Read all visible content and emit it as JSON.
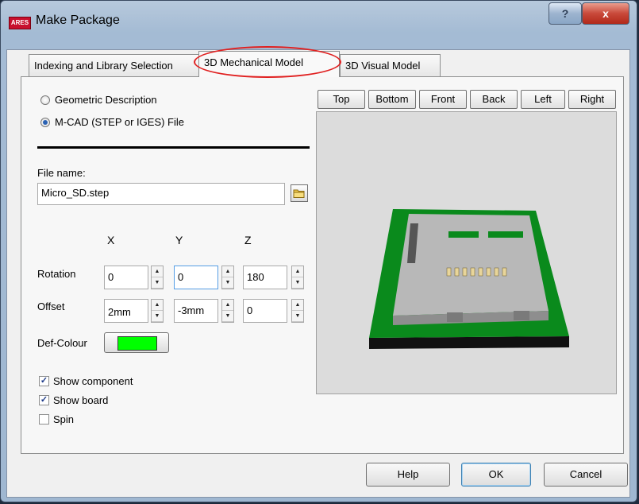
{
  "window": {
    "title": "Make Package",
    "app_badge": "ARES",
    "help_glyph": "?",
    "close_glyph": "x"
  },
  "tabs": [
    {
      "label": "Indexing and Library Selection"
    },
    {
      "label": "3D Mechanical Model"
    },
    {
      "label": "3D Visual Model"
    }
  ],
  "source": {
    "option_geometric": "Geometric Description",
    "option_mcad": "M-CAD (STEP or IGES) File",
    "selected": "mcad"
  },
  "file": {
    "label": "File name:",
    "value": "Micro_SD.step"
  },
  "axes": {
    "x": "X",
    "y": "Y",
    "z": "Z"
  },
  "rotation": {
    "label": "Rotation",
    "x": "0",
    "y": "0",
    "z": "180"
  },
  "offset": {
    "label": "Offset",
    "x": "2mm",
    "y": "-3mm",
    "z": "0"
  },
  "colour": {
    "label": "Def-Colour",
    "value": "#00ff00"
  },
  "options": {
    "show_component": {
      "label": "Show component",
      "checked": true
    },
    "show_board": {
      "label": "Show board",
      "checked": true
    },
    "spin": {
      "label": "Spin",
      "checked": false
    }
  },
  "view_buttons": [
    "Top",
    "Bottom",
    "Front",
    "Back",
    "Left",
    "Right"
  ],
  "footer": {
    "help": "Help",
    "ok": "OK",
    "cancel": "Cancel"
  },
  "spin_glyphs": {
    "up": "▲",
    "down": "▼"
  }
}
